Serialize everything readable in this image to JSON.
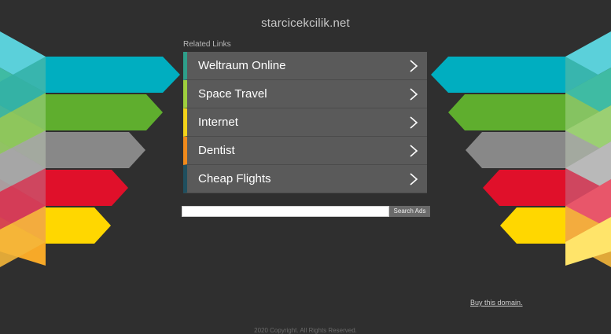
{
  "domain": "starcicekcilik.net",
  "related_heading": "Related Links",
  "links": [
    {
      "label": "Weltraum Online",
      "accent": "#2e9f8a"
    },
    {
      "label": "Space Travel",
      "accent": "#9ecf3e"
    },
    {
      "label": "Internet",
      "accent": "#f3d31a"
    },
    {
      "label": "Dentist",
      "accent": "#f08a1c"
    },
    {
      "label": "Cheap Flights",
      "accent": "#1f4f5f"
    }
  ],
  "search": {
    "placeholder": "",
    "button_label": "Search Ads"
  },
  "buy_link": "Buy this domain.",
  "copyright": "2020 Copyright. All Rights Reserved.",
  "colors": {
    "background": "#2f2f2f",
    "stripe_teal": "#00aec0",
    "stripe_green": "#5fae2e",
    "stripe_gray": "#888888",
    "stripe_red": "#e0102a",
    "stripe_yellow": "#ffd700"
  }
}
